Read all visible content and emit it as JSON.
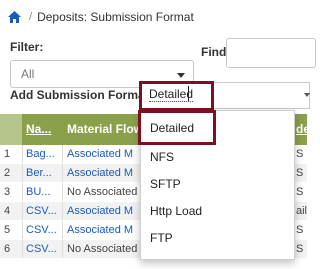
{
  "breadcrumb": {
    "separator": "/",
    "current": "Deposits: Submission Format"
  },
  "filter": {
    "label": "Filter:",
    "value": "All"
  },
  "find": {
    "label": "Find"
  },
  "add_format": {
    "label": "Add Submission Format",
    "input_value": "Detailed"
  },
  "dropdown": {
    "options": [
      "Detailed",
      "NFS",
      "SFTP",
      "Http Load",
      "FTP"
    ],
    "selected": "Detailed"
  },
  "table": {
    "columns": [
      "Na...",
      "Material Flow",
      "de"
    ],
    "rows": [
      {
        "num": "1",
        "name": "Bag...",
        "material_flow": "Associated M",
        "tail": "S"
      },
      {
        "num": "2",
        "name": "Ber...",
        "material_flow": "Associated M",
        "tail": "S"
      },
      {
        "num": "3",
        "name": "BU...",
        "material_flow": "No Associated",
        "tail": "S"
      },
      {
        "num": "4",
        "name": "CSV...",
        "material_flow": "Associated M",
        "tail": "ail"
      },
      {
        "num": "5",
        "name": "CSV...",
        "material_flow": "Associated M",
        "tail": "S"
      },
      {
        "num": "6",
        "name": "CSV...",
        "material_flow": "No Associated Material Flows",
        "tail": "S"
      }
    ]
  },
  "colors": {
    "header_bg": "#8aa04a",
    "highlight_border": "#7d1023",
    "link": "#1a5bb8"
  }
}
